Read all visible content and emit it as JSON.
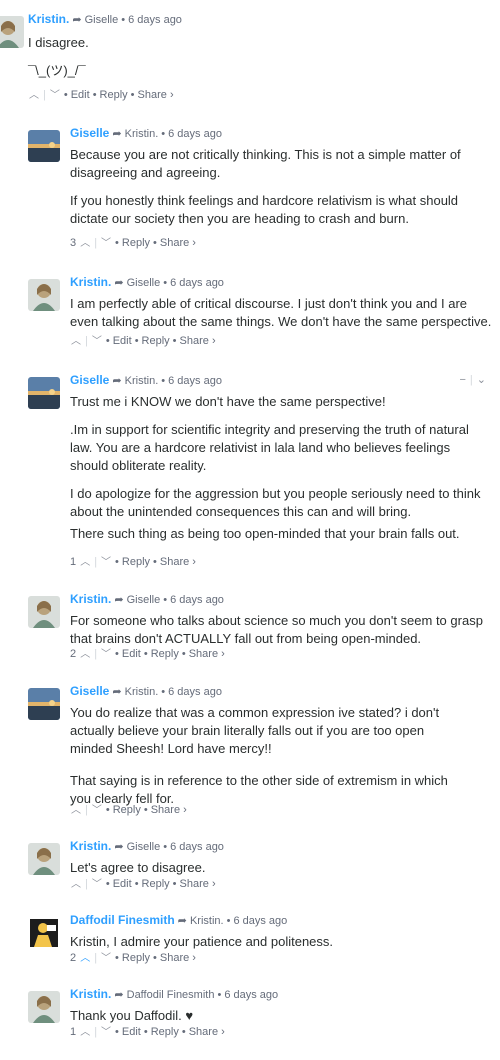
{
  "comments": [
    {
      "author": "Kristin.",
      "reply_to": "Giselle",
      "time": "6 days ago",
      "avatar": "avatar-kristin",
      "paragraphs": [
        "I disagree.",
        "¯\\_(ツ)_/¯"
      ],
      "votes": "",
      "actions": [
        "Edit",
        "Reply",
        "Share ›"
      ]
    },
    {
      "author": "Giselle",
      "reply_to": "Kristin.",
      "time": "6 days ago",
      "avatar": "avatar-giselle",
      "paragraphs": [
        "Because you are not critically thinking. This is not a simple matter of disagreeing and agreeing.",
        "If you honestly think feelings and hardcore relativism is what should dictate our society then you are heading to crash and burn."
      ],
      "votes": "3",
      "actions": [
        "Reply",
        "Share ›"
      ]
    },
    {
      "author": "Kristin.",
      "reply_to": "Giselle",
      "time": "6 days ago",
      "avatar": "avatar-kristin",
      "paragraphs": [
        "I am perfectly able of critical discourse. I just don't think you and I are even talking about the same things. We don't have the same perspective."
      ],
      "votes": "",
      "actions": [
        "Edit",
        "Reply",
        "Share ›"
      ]
    },
    {
      "author": "Giselle",
      "reply_to": "Kristin.",
      "time": "6 days ago",
      "avatar": "avatar-giselle",
      "paragraphs": [
        "Trust me i KNOW we don't have the same perspective!",
        ".Im in support for scientific integrity and preserving the truth of natural law. You are a hardcore relativist in lala land who believes feelings should obliterate reality.",
        "I do apologize for the aggression but you people seriously need to think about the unintended consequences this can and will bring.",
        "There such thing as being too open-minded that your brain falls out."
      ],
      "votes": "1",
      "actions": [
        "Reply",
        "Share ›"
      ],
      "collapse": {
        "minus": "−",
        "chevron": "⌄"
      }
    },
    {
      "author": "Kristin.",
      "reply_to": "Giselle",
      "time": "6 days ago",
      "avatar": "avatar-kristin",
      "paragraphs": [
        "For someone who talks about science so much you don't seem to grasp that brains don't ACTUALLY fall out from being open-minded."
      ],
      "votes": "2",
      "actions": [
        "Edit",
        "Reply",
        "Share ›"
      ]
    },
    {
      "author": "Giselle",
      "reply_to": "Kristin.",
      "time": "6 days ago",
      "avatar": "avatar-giselle",
      "paragraphs": [
        "You do realize that was a common expression ive stated? i don't actually believe your brain literally falls out if you are too open minded Sheesh! Lord have mercy!!",
        "That saying is in reference to the other side of extremism in which you clearly fell for."
      ],
      "votes": "",
      "actions": [
        "Reply",
        "Share ›"
      ]
    },
    {
      "author": "Kristin.",
      "reply_to": "Giselle",
      "time": "6 days ago",
      "avatar": "avatar-kristin",
      "paragraphs": [
        "Let's agree to disagree."
      ],
      "votes": "",
      "actions": [
        "Edit",
        "Reply",
        "Share ›"
      ]
    },
    {
      "author": "Daffodil Finesmith",
      "reply_to": "Kristin.",
      "time": "6 days ago",
      "avatar": "avatar-daffodil",
      "paragraphs": [
        "Kristin, I admire your patience and politeness."
      ],
      "votes": "2",
      "actions": [
        "Reply",
        "Share ›"
      ]
    },
    {
      "author": "Kristin.",
      "reply_to": "Daffodil Finesmith",
      "time": "6 days ago",
      "avatar": "avatar-kristin",
      "paragraphs": [
        "Thank you Daffodil. ♥"
      ],
      "votes": "1",
      "actions": [
        "Edit",
        "Reply",
        "Share ›"
      ]
    }
  ],
  "glyphs": {
    "arrow": "➦",
    "dot": "•",
    "up": "︿",
    "down": "﹀",
    "bar": "|"
  },
  "colors": {
    "author": "#2e9fff",
    "meta": "#656c7a",
    "text": "#2a2e2e"
  }
}
